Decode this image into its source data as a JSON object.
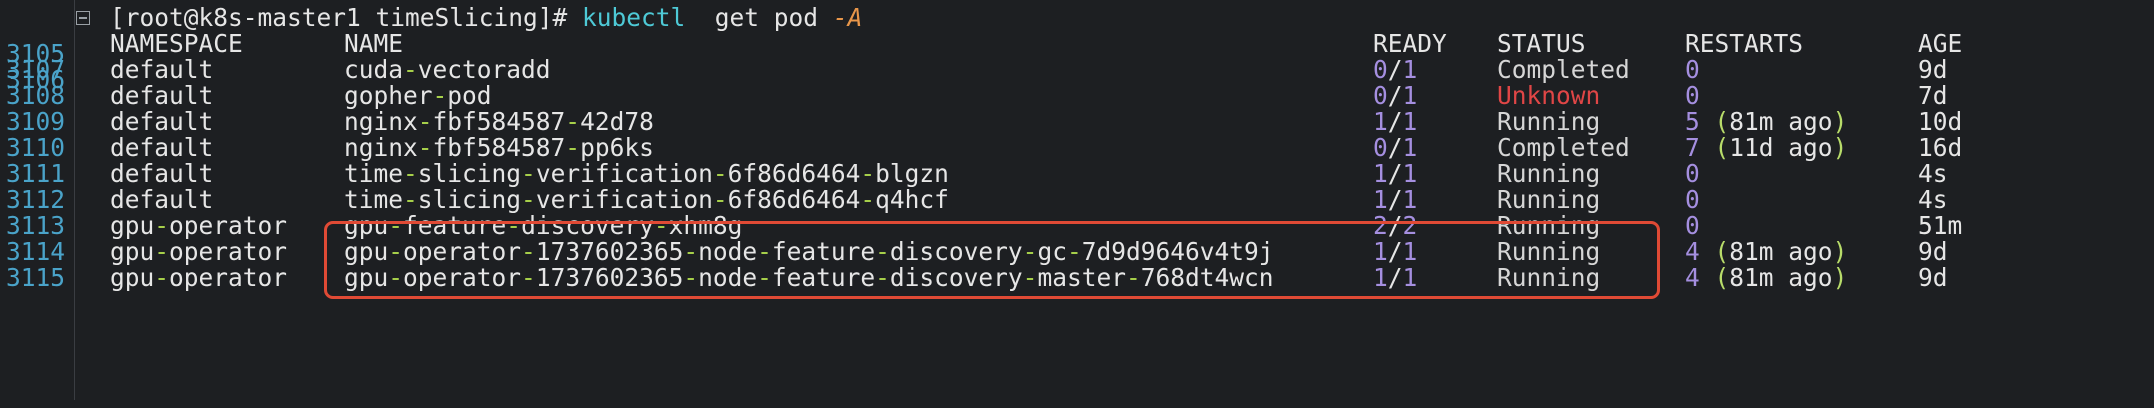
{
  "terminal": {
    "prompt": {
      "line_number": "3105",
      "prompt_text": "[root@k8s-master1 timeSlicing]#",
      "command": "kubectl",
      "args": "  get pod",
      "flag": "-A"
    },
    "header": {
      "line_number": "3106",
      "namespace": "NAMESPACE",
      "name": "NAME",
      "ready": "READY",
      "status": "STATUS",
      "restarts": "RESTARTS",
      "age": "AGE"
    },
    "rows": [
      {
        "line_number": "3107",
        "namespace_parts": [
          "default"
        ],
        "name_parts": [
          "cuda",
          "vectoradd"
        ],
        "ready_a": "0",
        "ready_b": "1",
        "status": "Completed",
        "status_color": "#d6d6d6",
        "restarts": "0",
        "ago": "",
        "age": "9d"
      },
      {
        "line_number": "3108",
        "namespace_parts": [
          "default"
        ],
        "name_parts": [
          "gopher",
          "pod"
        ],
        "ready_a": "0",
        "ready_b": "1",
        "status": "Unknown",
        "status_color": "#e04646",
        "restarts": "0",
        "ago": "",
        "age": "7d"
      },
      {
        "line_number": "3109",
        "namespace_parts": [
          "default"
        ],
        "name_parts": [
          "nginx",
          "fbf584587",
          "42d78"
        ],
        "ready_a": "1",
        "ready_b": "1",
        "status": "Running",
        "status_color": "#d6d6d6",
        "restarts": "5",
        "ago": "81m ago",
        "age": "10d"
      },
      {
        "line_number": "3110",
        "namespace_parts": [
          "default"
        ],
        "name_parts": [
          "nginx",
          "fbf584587",
          "pp6ks"
        ],
        "ready_a": "0",
        "ready_b": "1",
        "status": "Completed",
        "status_color": "#d6d6d6",
        "restarts": "7",
        "ago": "11d ago",
        "age": "16d"
      },
      {
        "line_number": "3111",
        "namespace_parts": [
          "default"
        ],
        "name_parts": [
          "time",
          "slicing",
          "verification",
          "6f86d6464",
          "blgzn"
        ],
        "ready_a": "1",
        "ready_b": "1",
        "status": "Running",
        "status_color": "#d6d6d6",
        "restarts": "0",
        "ago": "",
        "age": "4s"
      },
      {
        "line_number": "3112",
        "namespace_parts": [
          "default"
        ],
        "name_parts": [
          "time",
          "slicing",
          "verification",
          "6f86d6464",
          "q4hcf"
        ],
        "ready_a": "1",
        "ready_b": "1",
        "status": "Running",
        "status_color": "#d6d6d6",
        "restarts": "0",
        "ago": "",
        "age": "4s"
      },
      {
        "line_number": "3113",
        "namespace_parts": [
          "gpu",
          "operator"
        ],
        "name_parts": [
          "gpu",
          "feature",
          "discovery",
          "xhm8g"
        ],
        "ready_a": "2",
        "ready_b": "2",
        "status": "Running",
        "status_color": "#d6d6d6",
        "restarts": "0",
        "ago": "",
        "age": "51m"
      },
      {
        "line_number": "3114",
        "namespace_parts": [
          "gpu",
          "operator"
        ],
        "name_parts": [
          "gpu",
          "operator",
          "1737602365",
          "node",
          "feature",
          "discovery",
          "gc",
          "7d9d9646v4t9j"
        ],
        "ready_a": "1",
        "ready_b": "1",
        "status": "Running",
        "status_color": "#d6d6d6",
        "restarts": "4",
        "ago": "81m ago",
        "age": "9d"
      },
      {
        "line_number": "3115",
        "namespace_parts": [
          "gpu",
          "operator"
        ],
        "name_parts": [
          "gpu",
          "operator",
          "1737602365",
          "node",
          "feature",
          "discovery",
          "master",
          "768dt4wcn"
        ],
        "ready_a": "1",
        "ready_b": "1",
        "status": "Running",
        "status_color": "#d6d6d6",
        "restarts": "4",
        "ago": "81m ago",
        "age": "9d"
      }
    ],
    "colors": {
      "background": "#1d1f22",
      "line_number": "#4aa3c9",
      "dash": "#a6cf4a",
      "number": "#a58fe0",
      "highlight_box": "#e04a35",
      "error_status": "#e04646"
    }
  }
}
